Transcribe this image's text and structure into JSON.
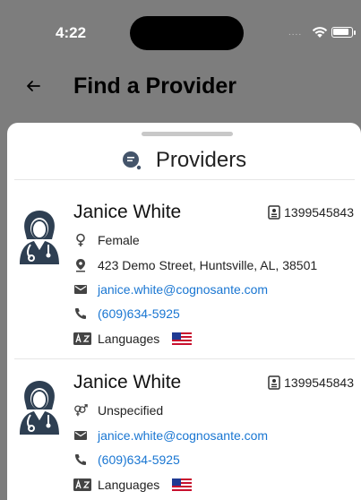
{
  "status_bar": {
    "time": "4:22",
    "signal": "....",
    "wifi_icon": "wifi-icon",
    "battery_icon": "battery-icon"
  },
  "header": {
    "title": "Find a Provider",
    "back_icon": "back-arrow-icon"
  },
  "sheet": {
    "title": "Providers",
    "title_icon": "providers-chat-icon"
  },
  "providers": [
    {
      "name": "Janice White",
      "npi": "1399545843",
      "gender": "Female",
      "gender_icon": "female-icon",
      "address": "423 Demo Street, Huntsville, AL, 38501",
      "email": "janice.white@cognosante.com",
      "phone": "(609)634-5925",
      "languages_label": "Languages",
      "language_flag": "us-flag-icon"
    },
    {
      "name": "Janice White",
      "npi": "1399545843",
      "gender": "Unspecified",
      "gender_icon": "unspecified-gender-icon",
      "email": "janice.white@cognosante.com",
      "phone": "(609)634-5925",
      "languages_label": "Languages",
      "language_flag": "us-flag-icon"
    }
  ],
  "colors": {
    "backdrop": "#7d7d7d",
    "link": "#1976d2",
    "text": "#222222",
    "avatar": "#2e3f52"
  }
}
